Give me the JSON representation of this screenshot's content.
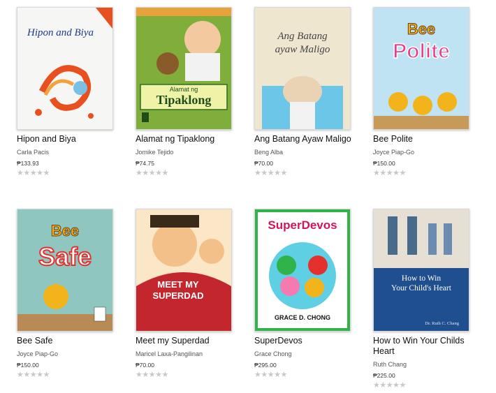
{
  "books": [
    {
      "title": "Hipon and Biya",
      "author": "Carla Pacis",
      "price": "₱133.93",
      "rating": 0,
      "cover": {
        "bg": "#f6f6f4",
        "accent": "#e8501f",
        "text": "Hipon and Biya",
        "text_color": "#1e3a8a"
      }
    },
    {
      "title": "Alamat ng Tipaklong",
      "author": "Jomike Tejido",
      "price": "₱74.75",
      "rating": 0,
      "cover": {
        "bg": "#7fae3a",
        "accent": "#d7e85b",
        "text": "Tipaklong",
        "text_color": "#1f4d1a"
      }
    },
    {
      "title": "Ang Batang Ayaw Maligo",
      "author": "Beng Alba",
      "price": "₱70.00",
      "rating": 0,
      "cover": {
        "bg": "#efe6d0",
        "accent": "#6cc6e8",
        "text": "Ang Batang Ayaw Maligo",
        "text_color": "#444"
      }
    },
    {
      "title": "Bee Polite",
      "author": "Joyce Piap-Go",
      "price": "₱150.00",
      "rating": 0,
      "cover": {
        "bg": "#bfe3f3",
        "accent": "#e83d8a",
        "text": "Polite",
        "text_color": "#e83d8a"
      }
    },
    {
      "title": "Bee Safe",
      "author": "Joyce Piap-Go",
      "price": "₱150.00",
      "rating": 0,
      "cover": {
        "bg": "#8fc7c0",
        "accent": "#e4312e",
        "text": "Safe",
        "text_color": "#ffffff"
      }
    },
    {
      "title": "Meet my Superdad",
      "author": "Maricel Laxa-Pangilinan",
      "price": "₱70.00",
      "rating": 0,
      "cover": {
        "bg": "#fbe6c8",
        "accent": "#c4262e",
        "text": "MEET MY SUPERDAD",
        "text_color": "#ffffff"
      }
    },
    {
      "title": "SuperDevos",
      "author": "Grace Chong",
      "price": "₱295.00",
      "rating": 0,
      "cover": {
        "bg": "#ffffff",
        "accent": "#2fb34a",
        "text": "SuperDevos",
        "text_color": "#d4145a"
      }
    },
    {
      "title": "How to Win Your Childs Heart",
      "author": "Ruth Chang",
      "price": "₱225.00",
      "rating": 0,
      "cover": {
        "bg": "#c8b79a",
        "accent": "#1f4f8f",
        "text": "How to Win Your Child's Heart",
        "text_color": "#ffffff"
      }
    }
  ],
  "rating_max": 5,
  "star_glyph": "★"
}
